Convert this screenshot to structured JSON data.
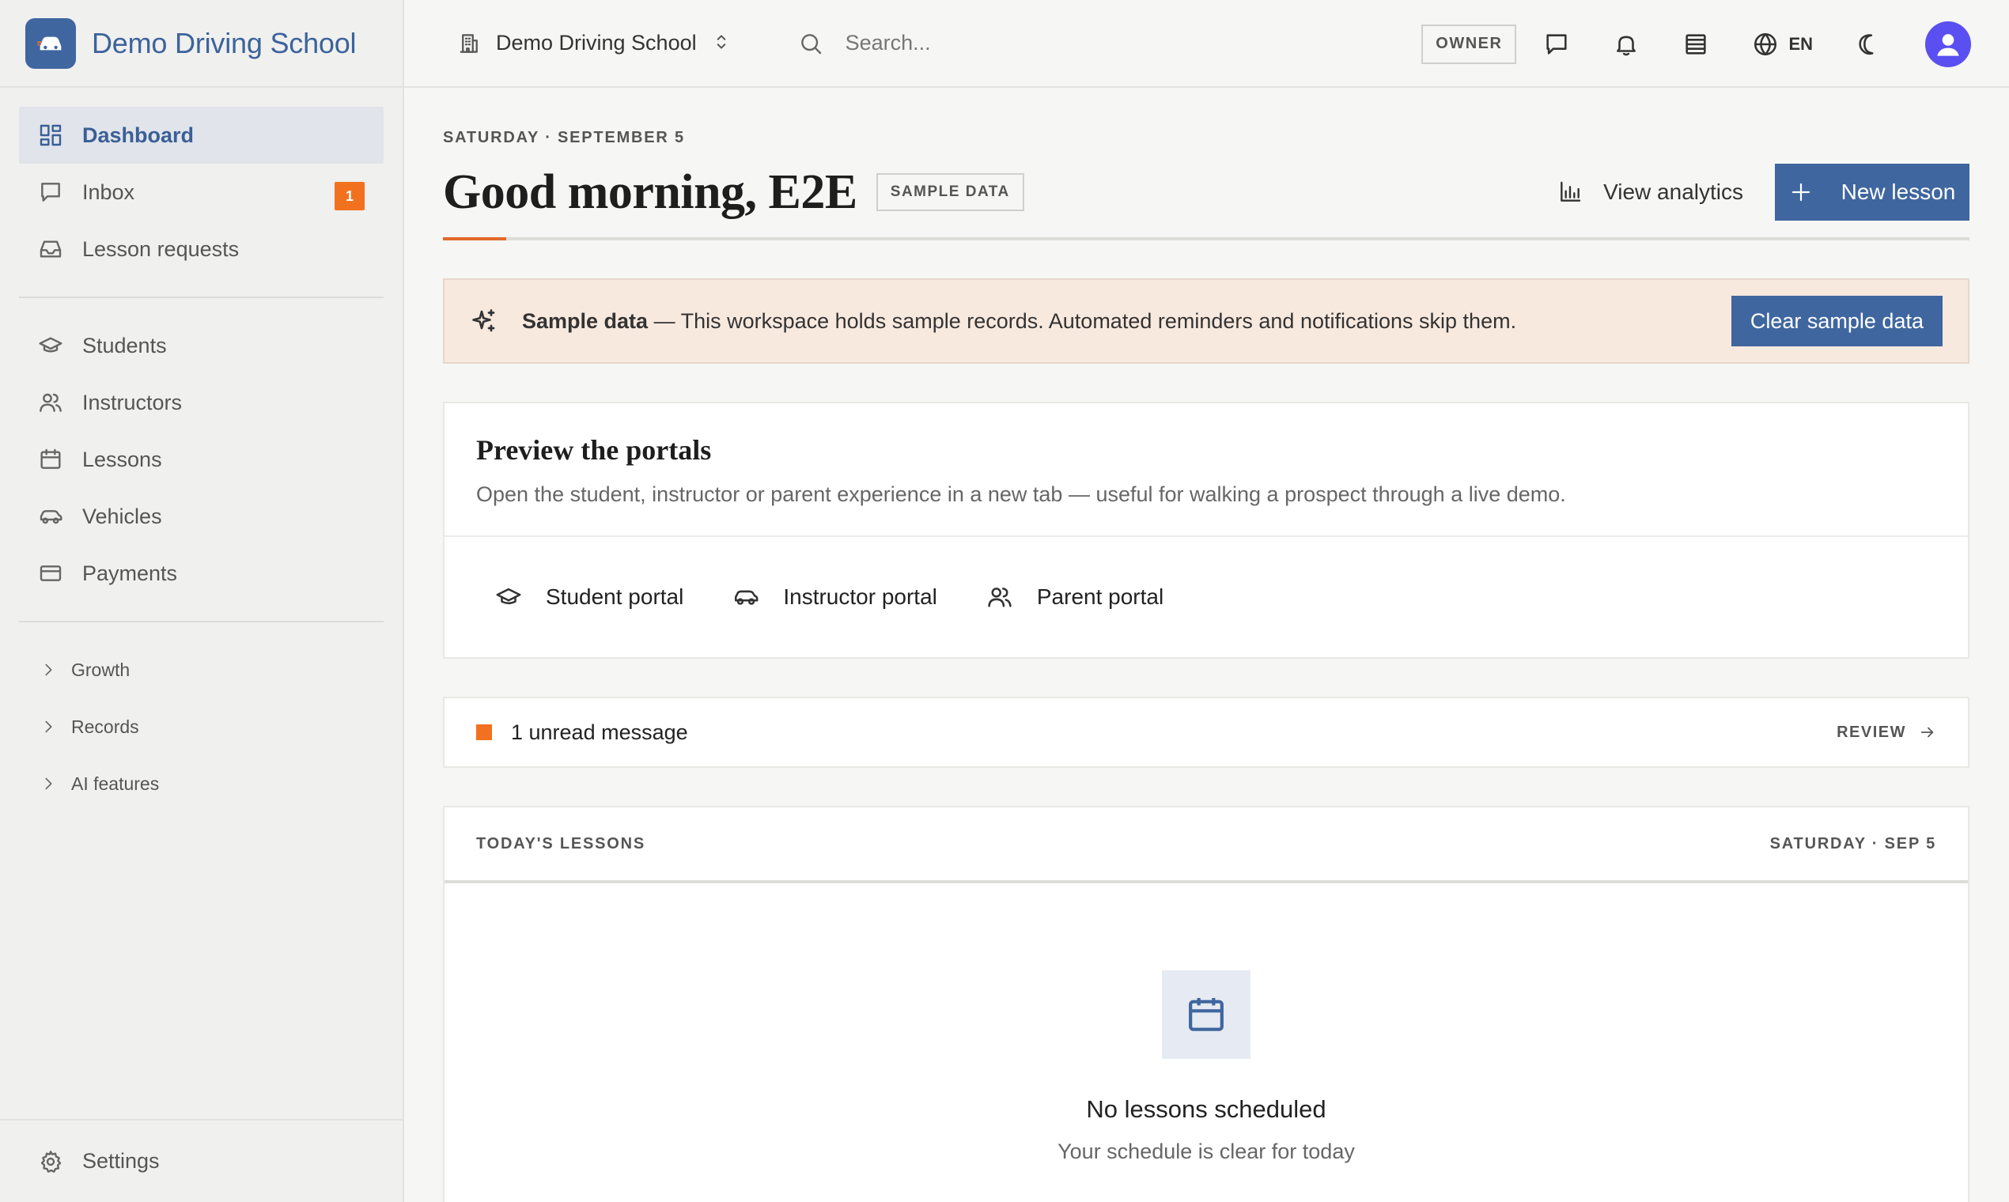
{
  "brand": {
    "name": "Demo Driving School"
  },
  "sidebar": {
    "items": [
      {
        "label": "Dashboard",
        "icon": "dashboard-grid-icon",
        "active": true
      },
      {
        "label": "Inbox",
        "icon": "chat-bubble-icon",
        "badge": "1"
      },
      {
        "label": "Lesson requests",
        "icon": "inbox-tray-icon"
      },
      {
        "label": "Students",
        "icon": "graduation-cap-icon"
      },
      {
        "label": "Instructors",
        "icon": "users-icon"
      },
      {
        "label": "Lessons",
        "icon": "calendar-icon"
      },
      {
        "label": "Vehicles",
        "icon": "car-icon"
      },
      {
        "label": "Payments",
        "icon": "credit-card-icon"
      }
    ],
    "groups": [
      {
        "label": "Growth"
      },
      {
        "label": "Records"
      },
      {
        "label": "AI features"
      }
    ],
    "settings_label": "Settings"
  },
  "topbar": {
    "workspace": "Demo Driving School",
    "search_placeholder": "Search...",
    "role": "OWNER",
    "language": "EN"
  },
  "main": {
    "date": "SATURDAY · SEPTEMBER 5",
    "greeting": "Good morning, E2E",
    "sample_pill": "SAMPLE DATA",
    "view_analytics": "View analytics",
    "new_lesson": "New lesson",
    "banner": {
      "title": "Sample data",
      "text": " — This workspace holds sample records. Automated reminders and notifications skip them.",
      "button": "Clear sample data"
    },
    "portals": {
      "title": "Preview the portals",
      "description": "Open the student, instructor or parent experience in a new tab — useful for walking a prospect through a live demo.",
      "links": [
        {
          "label": "Student portal",
          "icon": "graduation-cap-icon"
        },
        {
          "label": "Instructor portal",
          "icon": "car-icon"
        },
        {
          "label": "Parent portal",
          "icon": "users-icon"
        }
      ]
    },
    "unread": {
      "text": "1 unread message",
      "action": "REVIEW"
    },
    "lessons": {
      "title": "TODAY'S LESSONS",
      "date": "SATURDAY · SEP 5",
      "empty_title": "No lessons scheduled",
      "empty_sub": "Your schedule is clear for today"
    }
  },
  "colors": {
    "accent": "#3f669f",
    "badge": "#f2711f",
    "banner_bg": "#f8e9df",
    "avatar": "#5a4ff0"
  }
}
